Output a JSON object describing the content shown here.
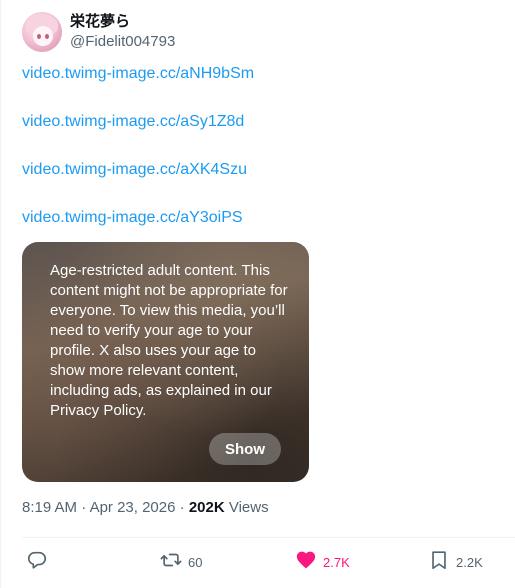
{
  "post": {
    "author": {
      "display_name": "栄花夢ら",
      "handle": "@Fidelit004793"
    },
    "links": [
      "video.twimg-image.cc/aNH9bSm",
      "video.twimg-image.cc/aSy1Z8d",
      "video.twimg-image.cc/aXK4Szu",
      "video.twimg-image.cc/aY3oiPS"
    ],
    "media_warning": {
      "text": "Age-restricted adult content. This content might not be appropriate for everyone. To view this media, you’ll need to verify your age to your profile. X also uses your age to show more relevant content, including ads, as explained in our Privacy Policy.",
      "show_label": "Show"
    },
    "meta": {
      "time": "8:19 AM",
      "separator": "·",
      "date": "Apr 23, 2026",
      "views_count": "202K",
      "views_label": "Views"
    },
    "actions": {
      "reply": {
        "icon": "reply-icon",
        "count": ""
      },
      "repost": {
        "icon": "repost-icon",
        "count": "60"
      },
      "like": {
        "icon": "heart-icon",
        "count": "2.7K",
        "liked": true,
        "color": "#f91880"
      },
      "bookmark": {
        "icon": "bookmark-icon",
        "count": "2.2K"
      }
    }
  },
  "colors": {
    "link": "#1d9bf0",
    "secondary_text": "#536471",
    "primary_text": "#0f1419",
    "like": "#f91880"
  }
}
